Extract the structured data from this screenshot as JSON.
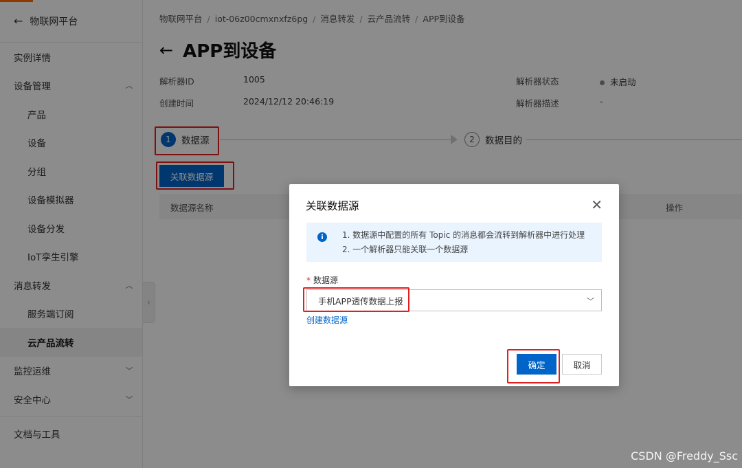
{
  "sidebar": {
    "back_label": "物联网平台",
    "items": [
      {
        "label": "实例详情",
        "sub": false,
        "chevron": ""
      },
      {
        "label": "设备管理",
        "sub": false,
        "chevron": "up"
      },
      {
        "label": "产品",
        "sub": true,
        "chevron": ""
      },
      {
        "label": "设备",
        "sub": true,
        "chevron": ""
      },
      {
        "label": "分组",
        "sub": true,
        "chevron": ""
      },
      {
        "label": "设备模拟器",
        "sub": true,
        "chevron": ""
      },
      {
        "label": "设备分发",
        "sub": true,
        "chevron": ""
      },
      {
        "label": "IoT孪生引擎",
        "sub": true,
        "chevron": ""
      },
      {
        "label": "消息转发",
        "sub": false,
        "chevron": "up"
      },
      {
        "label": "服务端订阅",
        "sub": true,
        "chevron": ""
      },
      {
        "label": "云产品流转",
        "sub": true,
        "chevron": "",
        "active": true
      },
      {
        "label": "监控运维",
        "sub": false,
        "chevron": "down"
      },
      {
        "label": "安全中心",
        "sub": false,
        "chevron": "down"
      },
      {
        "label": "文档与工具",
        "sub": false,
        "chevron": ""
      }
    ]
  },
  "breadcrumb": [
    "物联网平台",
    "iot-06z00cmxnxfz6pg",
    "消息转发",
    "云产品流转",
    "APP到设备"
  ],
  "page_title": "APP到设备",
  "info": {
    "parser_id_label": "解析器ID",
    "parser_id_value": "1005",
    "created_label": "创建时间",
    "created_value": "2024/12/12 20:46:19",
    "status_label": "解析器状态",
    "status_value": "未启动",
    "desc_label": "解析器描述",
    "desc_value": "-"
  },
  "steps": [
    {
      "num": "1",
      "label": "数据源"
    },
    {
      "num": "2",
      "label": "数据目的"
    }
  ],
  "associate_button": "关联数据源",
  "table": {
    "col_name": "数据源名称",
    "col_action": "操作"
  },
  "modal": {
    "title": "关联数据源",
    "notice_line1": "1. 数据源中配置的所有 Topic 的消息都会流转到解析器中进行处理",
    "notice_line2": "2. 一个解析器只能关联一个数据源",
    "field_label": "数据源",
    "field_required": "*",
    "select_value": "手机APP透传数据上报",
    "create_link": "创建数据源",
    "ok_label": "确定",
    "cancel_label": "取消"
  },
  "watermark": "CSDN @Freddy_Ssc",
  "colors": {
    "primary": "#0064c8",
    "highlight": "#e02020",
    "accent": "#ff6a00"
  }
}
